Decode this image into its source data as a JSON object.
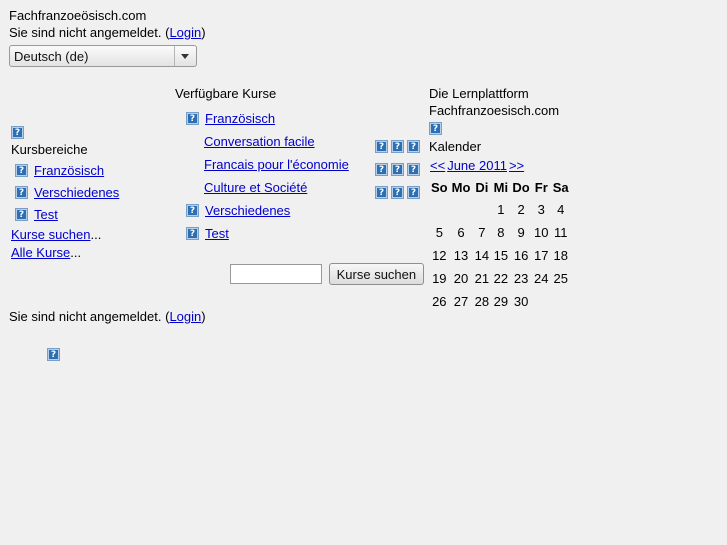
{
  "page": {
    "background_color": "#f0f0f0",
    "link_color": "#0000cc"
  },
  "header": {
    "site_title": "Fachfranzoeösisch.com",
    "login_prefix": "Sie sind nicht angemeldet. (",
    "login_label": "Login",
    "login_suffix": ")",
    "language_select": {
      "name": "language-select",
      "selected": "Deutsch (de)",
      "options": [
        "Deutsch (de)"
      ],
      "arrow_icon": "chevron-down-icon"
    }
  },
  "sidebar": {
    "block_icon": "broken-image-icon",
    "title": "Kursbereiche",
    "categories": [
      {
        "icon": "broken-image-icon",
        "label": "Französisch"
      },
      {
        "icon": "broken-image-icon",
        "label": "Verschiedenes"
      },
      {
        "icon": "broken-image-icon",
        "label": "Test"
      }
    ],
    "links": [
      {
        "label": "Kurse suchen",
        "suffix": "..."
      },
      {
        "label": "Alle Kurse",
        "suffix": "..."
      }
    ]
  },
  "center": {
    "heading": "Verfügbare Kurse",
    "category_1": {
      "icon": "broken-image-icon",
      "label": "Französisch"
    },
    "courses": [
      {
        "label": "Conversation facile",
        "icons": [
          "broken-image-icon",
          "broken-image-icon",
          "broken-image-icon"
        ]
      },
      {
        "label": "Francais pour l'économie",
        "icons": [
          "broken-image-icon",
          "broken-image-icon",
          "broken-image-icon"
        ]
      },
      {
        "label": "Culture et Société",
        "icons": [
          "broken-image-icon",
          "broken-image-icon",
          "broken-image-icon"
        ]
      }
    ],
    "category_2": {
      "icon": "broken-image-icon",
      "label": "Verschiedenes"
    },
    "category_3": {
      "icon": "broken-image-icon",
      "label": "Test"
    },
    "search": {
      "value": "",
      "placeholder": "",
      "button_label": "Kurse suchen"
    }
  },
  "right": {
    "tagline_line1": "Die Lernplattform",
    "tagline_line2": "Fachfranzoesisch.com",
    "block_icon": "broken-image-icon",
    "title": "Kalender",
    "calendar": {
      "prev_label": "<<",
      "month_label": "June 2011",
      "next_label": ">>",
      "weekdays": [
        "So",
        "Mo",
        "Di",
        "Mi",
        "Do",
        "Fr",
        "Sa"
      ],
      "weeks": [
        [
          "",
          "",
          "",
          "1",
          "2",
          "3",
          "4"
        ],
        [
          "5",
          "6",
          "7",
          "8",
          "9",
          "10",
          "11"
        ],
        [
          "12",
          "13",
          "14",
          "15",
          "16",
          "17",
          "18"
        ],
        [
          "19",
          "20",
          "21",
          "22",
          "23",
          "24",
          "25"
        ],
        [
          "26",
          "27",
          "28",
          "29",
          "30",
          "",
          ""
        ]
      ]
    }
  },
  "footer": {
    "login_prefix": "Sie sind nicht angemeldet. (",
    "login_label": "Login",
    "login_suffix": ")",
    "icon": "broken-image-icon"
  }
}
